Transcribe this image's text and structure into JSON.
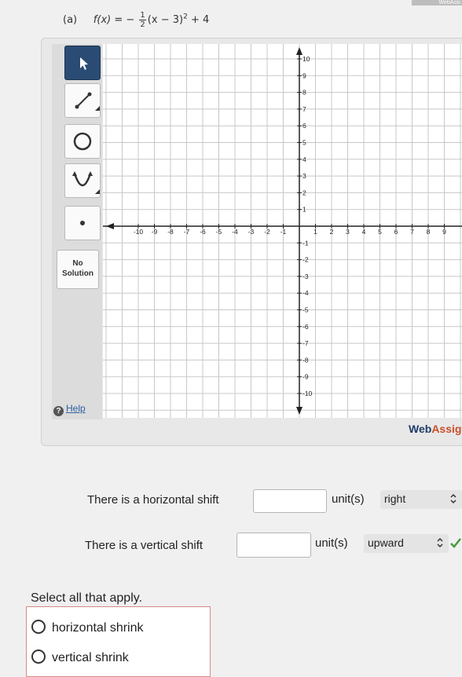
{
  "brand_corner": "WebAssi",
  "problem": {
    "part_label": "(a)",
    "function_name": "f(x)",
    "equals": "= −",
    "frac_num": "1",
    "frac_den": "2",
    "rest": "(x − 3)",
    "exp": "2",
    "tail": "+ 4"
  },
  "toolbar": {
    "tools": [
      "select-pointer",
      "line-segment",
      "circle",
      "parabola",
      "point"
    ],
    "no_solution_line1": "No",
    "no_solution_line2": "Solution",
    "help_label": "Help",
    "help_icon": "?"
  },
  "graph": {
    "x_ticks": [
      "-10",
      "-9",
      "-8",
      "-7",
      "-6",
      "-5",
      "-4",
      "-3",
      "-2",
      "-1",
      "1",
      "2",
      "3",
      "4",
      "5",
      "6",
      "7",
      "8",
      "9"
    ],
    "y_ticks": [
      "10",
      "9",
      "8",
      "7",
      "6",
      "5",
      "4",
      "3",
      "2",
      "1",
      "-1",
      "-2",
      "-3",
      "-4",
      "-5",
      "-6",
      "-7",
      "-8",
      "-9",
      "-10"
    ],
    "xlim": [
      -10,
      9
    ],
    "ylim": [
      -10,
      10
    ]
  },
  "brand": {
    "main": "Web",
    "accent": "Assig"
  },
  "questions": {
    "horizontal_text": "There is a horizontal shift",
    "horizontal_units": "unit(s)",
    "horizontal_direction": "right",
    "horizontal_value": "",
    "vertical_text": "There is a vertical shift",
    "vertical_units": "unit(s)",
    "vertical_direction": "upward",
    "vertical_value": ""
  },
  "apply": {
    "title": "Select all that apply.",
    "options": [
      "horizontal shrink",
      "vertical shrink"
    ]
  },
  "colors": {
    "active_tool": "#2a4b73",
    "brand": "#1f3c68",
    "brand_accent": "#c8502a",
    "check": "#4a9a3a"
  }
}
